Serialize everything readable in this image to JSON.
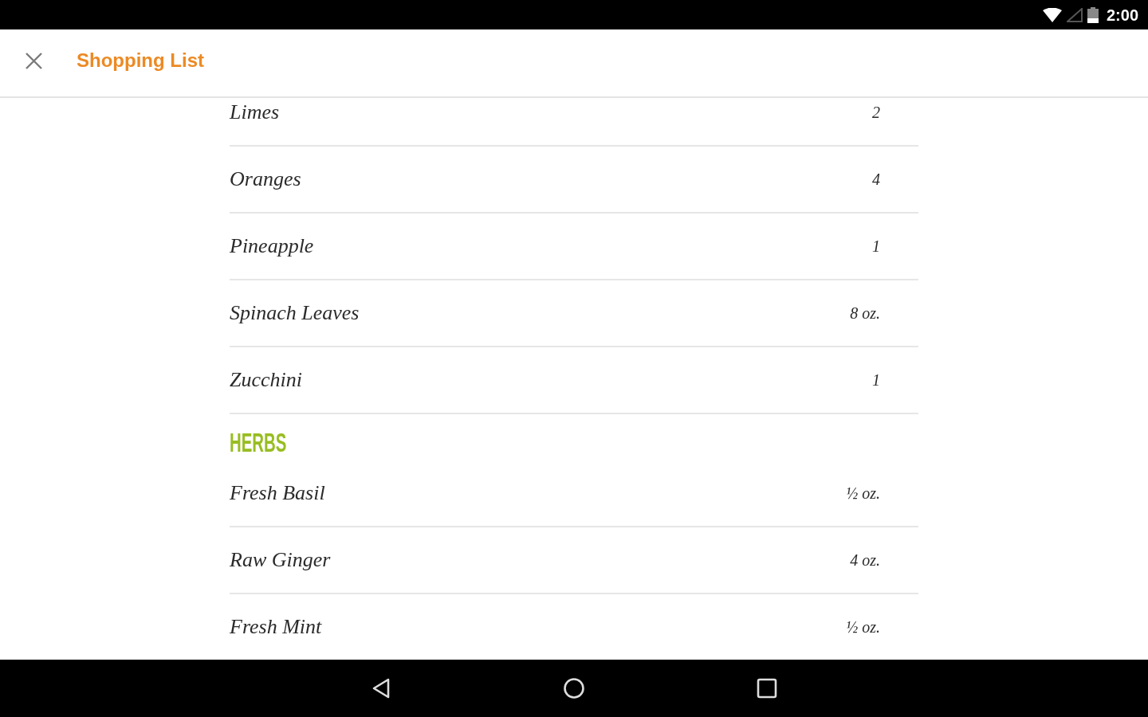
{
  "status_bar": {
    "time": "2:00"
  },
  "app_bar": {
    "title": "Shopping List"
  },
  "sections": [
    {
      "items": [
        {
          "name": "Limes",
          "quantity": "2"
        },
        {
          "name": "Oranges",
          "quantity": "4"
        },
        {
          "name": "Pineapple",
          "quantity": "1"
        },
        {
          "name": "Spinach Leaves",
          "quantity": "8 oz."
        },
        {
          "name": "Zucchini",
          "quantity": "1"
        }
      ]
    },
    {
      "heading": "HERBS",
      "items": [
        {
          "name": "Fresh Basil",
          "quantity": "½ oz."
        },
        {
          "name": "Raw Ginger",
          "quantity": "4 oz."
        },
        {
          "name": "Fresh Mint",
          "quantity": "½ oz."
        }
      ]
    }
  ]
}
